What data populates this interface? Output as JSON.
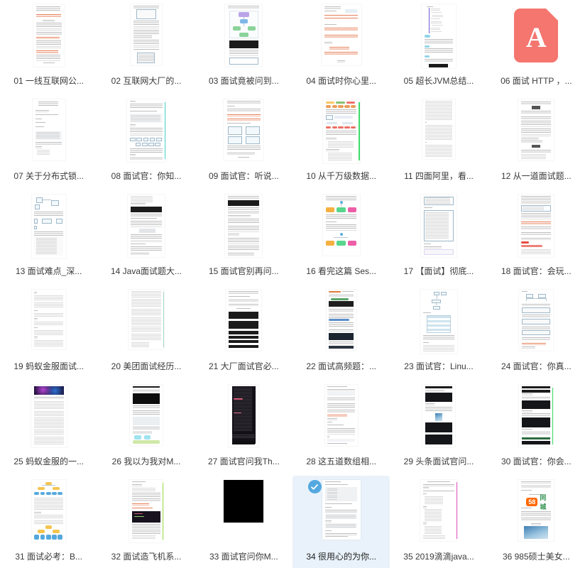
{
  "view": {
    "type": "icon-grid",
    "columns": 6,
    "rows": 6,
    "background": "#ffffff",
    "selection_color": "#e9f2fa",
    "checkmark_color": "#54a8e0",
    "label_color": "#3a3a3a"
  },
  "files": [
    {
      "index": "01",
      "label": "01 一线互联网公...",
      "thumb": "doc-red-annotated",
      "selected": false
    },
    {
      "index": "02",
      "label": "02 互联网大厂的...",
      "thumb": "doc-with-figure",
      "selected": false
    },
    {
      "index": "03",
      "label": "03 面试竟被问到...",
      "thumb": "doc-flowchart",
      "selected": false
    },
    {
      "index": "04",
      "label": "04 面试时你心里...",
      "thumb": "doc-orange-tables",
      "selected": false
    },
    {
      "index": "05",
      "label": "05 超长JVM总结...",
      "thumb": "doc-mindmap",
      "selected": false
    },
    {
      "index": "06",
      "label": "06 面试 HTTP ，...",
      "thumb": "pdf-icon",
      "selected": false
    },
    {
      "index": "07",
      "label": "07 关于分布式锁...",
      "thumb": "doc-plain",
      "selected": false
    },
    {
      "index": "08",
      "label": "08 面试官：你知...",
      "thumb": "doc-diagram-boxes",
      "selected": false
    },
    {
      "index": "09",
      "label": "09 面试官：听说...",
      "thumb": "doc-memory-tables",
      "selected": false
    },
    {
      "index": "10",
      "label": "10 从千万级数据...",
      "thumb": "doc-colored-headers",
      "selected": false
    },
    {
      "index": "11",
      "label": "11 四面阿里，看...",
      "thumb": "doc-dense-text",
      "selected": false
    },
    {
      "index": "12",
      "label": "12 从一道面试题...",
      "thumb": "doc-centered-badges",
      "selected": false
    },
    {
      "index": "13",
      "label": "13 面试难点_深...",
      "thumb": "doc-flow-and-code",
      "selected": false
    },
    {
      "index": "14",
      "label": "14 Java面试题大...",
      "thumb": "doc-dark-banner",
      "selected": false
    },
    {
      "index": "15",
      "label": "15 面试官别再问...",
      "thumb": "doc-dark-header",
      "selected": false
    },
    {
      "index": "16",
      "label": "16 看完这篇 Ses...",
      "thumb": "doc-color-blocks",
      "selected": false
    },
    {
      "index": "17",
      "label": "17 【面试】彻底...",
      "thumb": "doc-code-panel",
      "selected": false
    },
    {
      "index": "18",
      "label": "18 面试官：会玩...",
      "thumb": "doc-red-highlight",
      "selected": false
    },
    {
      "index": "19",
      "label": "19 蚂蚁金服面试...",
      "thumb": "doc-plain-gray",
      "selected": false
    },
    {
      "index": "20",
      "label": "20 美团面试经历...",
      "thumb": "doc-small-text",
      "selected": false
    },
    {
      "index": "21",
      "label": "21 大厂面试官必...",
      "thumb": "doc-black-bars",
      "selected": false
    },
    {
      "index": "22",
      "label": "22 面试高频题：...",
      "thumb": "doc-web-article",
      "selected": false
    },
    {
      "index": "23",
      "label": "23 面试官：Linu...",
      "thumb": "doc-blue-table",
      "selected": false
    },
    {
      "index": "24",
      "label": "24 面试官：你真...",
      "thumb": "doc-form-boxes",
      "selected": false
    },
    {
      "index": "25",
      "label": "25 蚂蚁金服的一...",
      "thumb": "doc-galaxy-banner",
      "selected": false
    },
    {
      "index": "26",
      "label": "26 我以为我对M...",
      "thumb": "doc-terminal-and-chart",
      "selected": false
    },
    {
      "index": "27",
      "label": "27 面试官问我Th...",
      "thumb": "doc-dark-code",
      "selected": false
    },
    {
      "index": "28",
      "label": "28 这五道数组相...",
      "thumb": "doc-article-plain",
      "selected": false
    },
    {
      "index": "29",
      "label": "29 头条面试官问...",
      "thumb": "doc-code-screens",
      "selected": false
    },
    {
      "index": "30",
      "label": "30 面试官：你会...",
      "thumb": "doc-code-blocks",
      "selected": false
    },
    {
      "index": "31",
      "label": "31 面试必考：B...",
      "thumb": "doc-btree-diagram",
      "selected": false
    },
    {
      "index": "32",
      "label": "32 面试造飞机系...",
      "thumb": "doc-code-dark-mid",
      "selected": false
    },
    {
      "index": "33",
      "label": "33 面试官问你M...",
      "thumb": "black-square",
      "selected": false
    },
    {
      "index": "34",
      "label": "34 很用心的为你...",
      "thumb": "doc-gray-list",
      "selected": true
    },
    {
      "index": "35",
      "label": "35 2019滴滴java...",
      "thumb": "doc-outline-text",
      "selected": false
    },
    {
      "index": "36",
      "label": "36 985硕士美女...",
      "thumb": "doc-58-logo",
      "selected": false
    }
  ]
}
